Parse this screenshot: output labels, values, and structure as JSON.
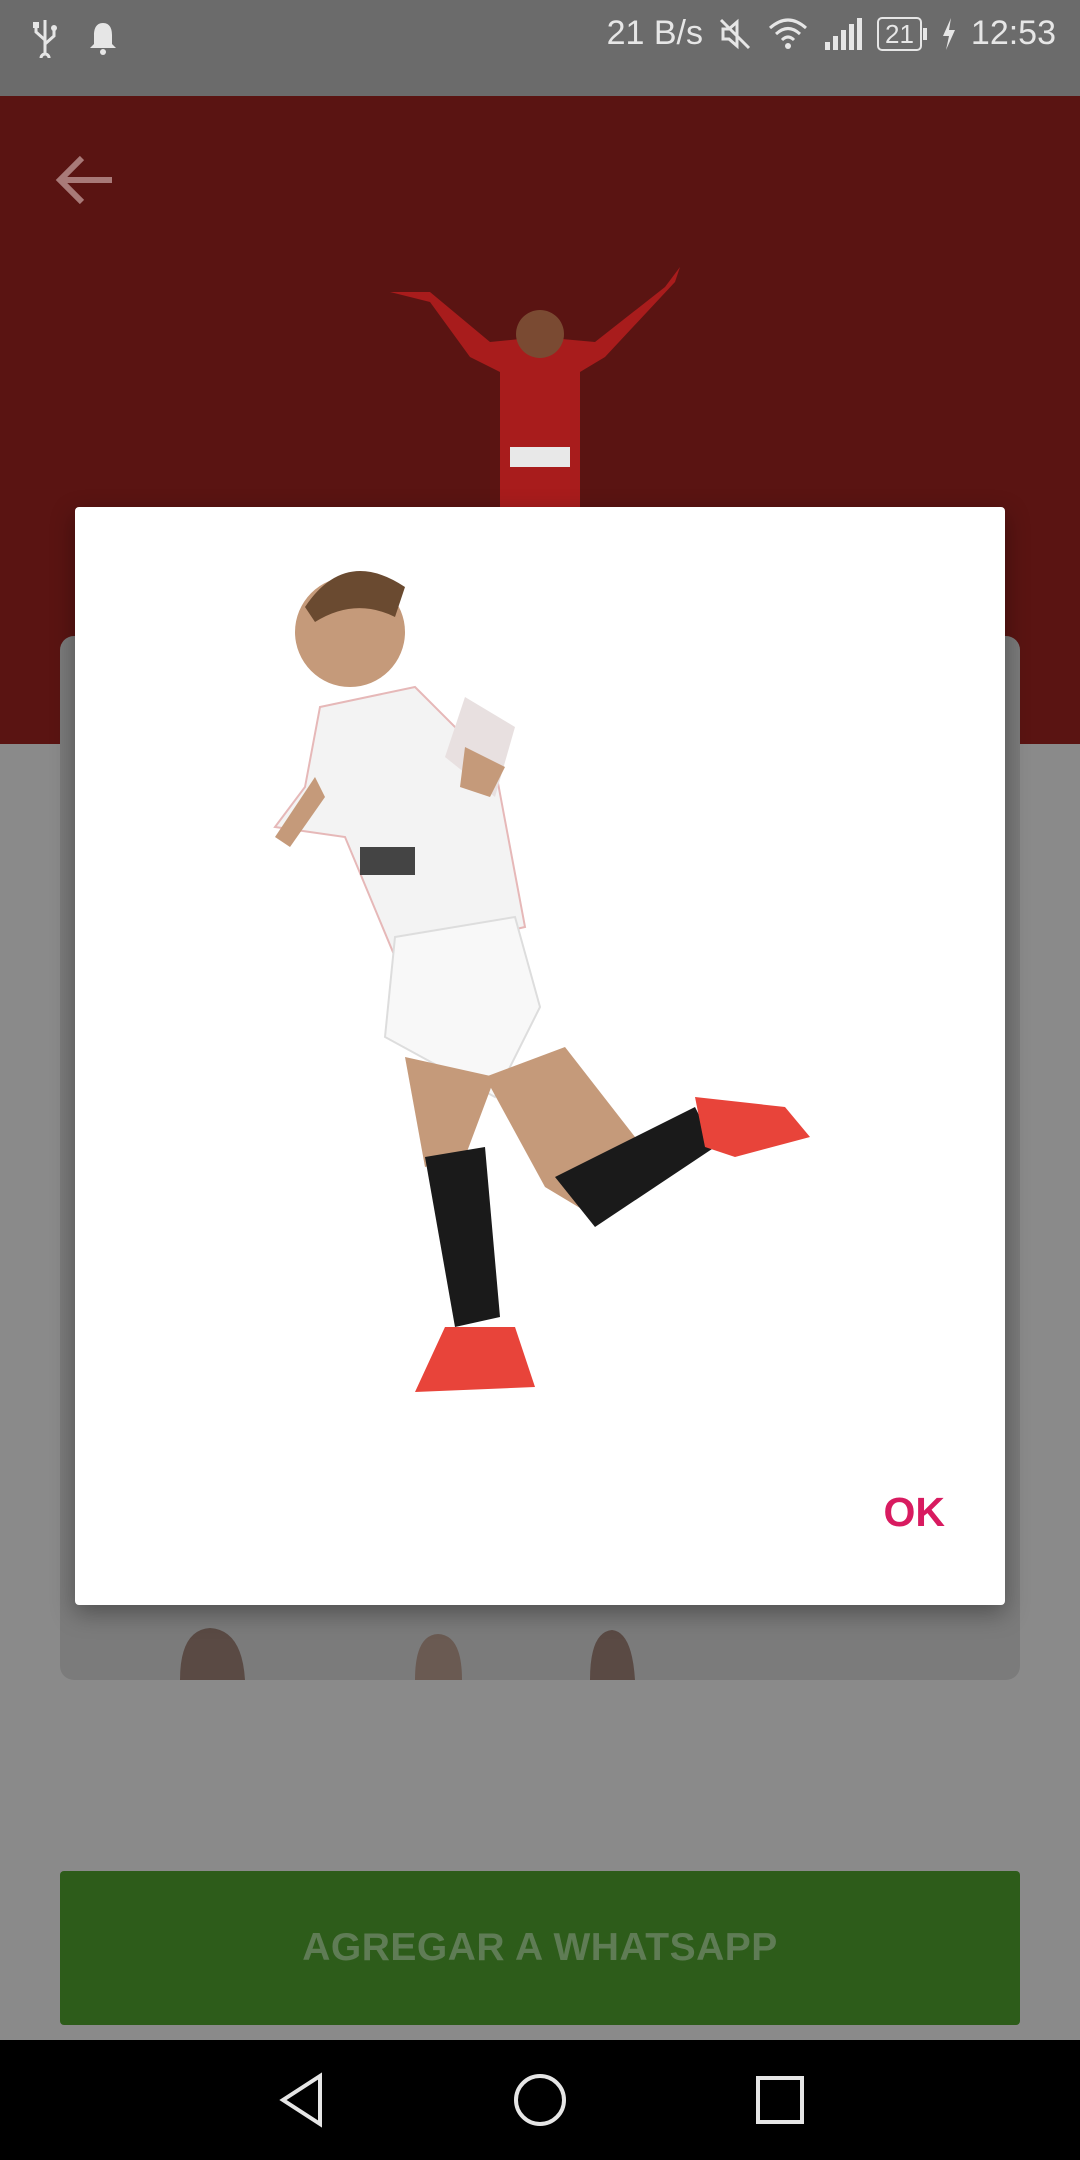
{
  "status_bar": {
    "net_speed": "21 B/s",
    "battery": "21",
    "time": "12:53",
    "icons": [
      "usb-icon",
      "notification-bell-icon",
      "mute-icon",
      "wifi-icon",
      "signal-icon",
      "battery-icon",
      "charging-icon"
    ]
  },
  "header": {
    "back_icon": "arrow-left-icon",
    "background_color": "#5a1412"
  },
  "dialog": {
    "ok_label": "OK",
    "ok_color": "#d81b60"
  },
  "footer": {
    "add_button_label": "AGREGAR A WHATSAPP",
    "add_button_color": "#2d5c1a"
  },
  "nav_bar": {
    "icons": [
      "back-triangle-icon",
      "home-circle-icon",
      "recents-square-icon"
    ]
  }
}
